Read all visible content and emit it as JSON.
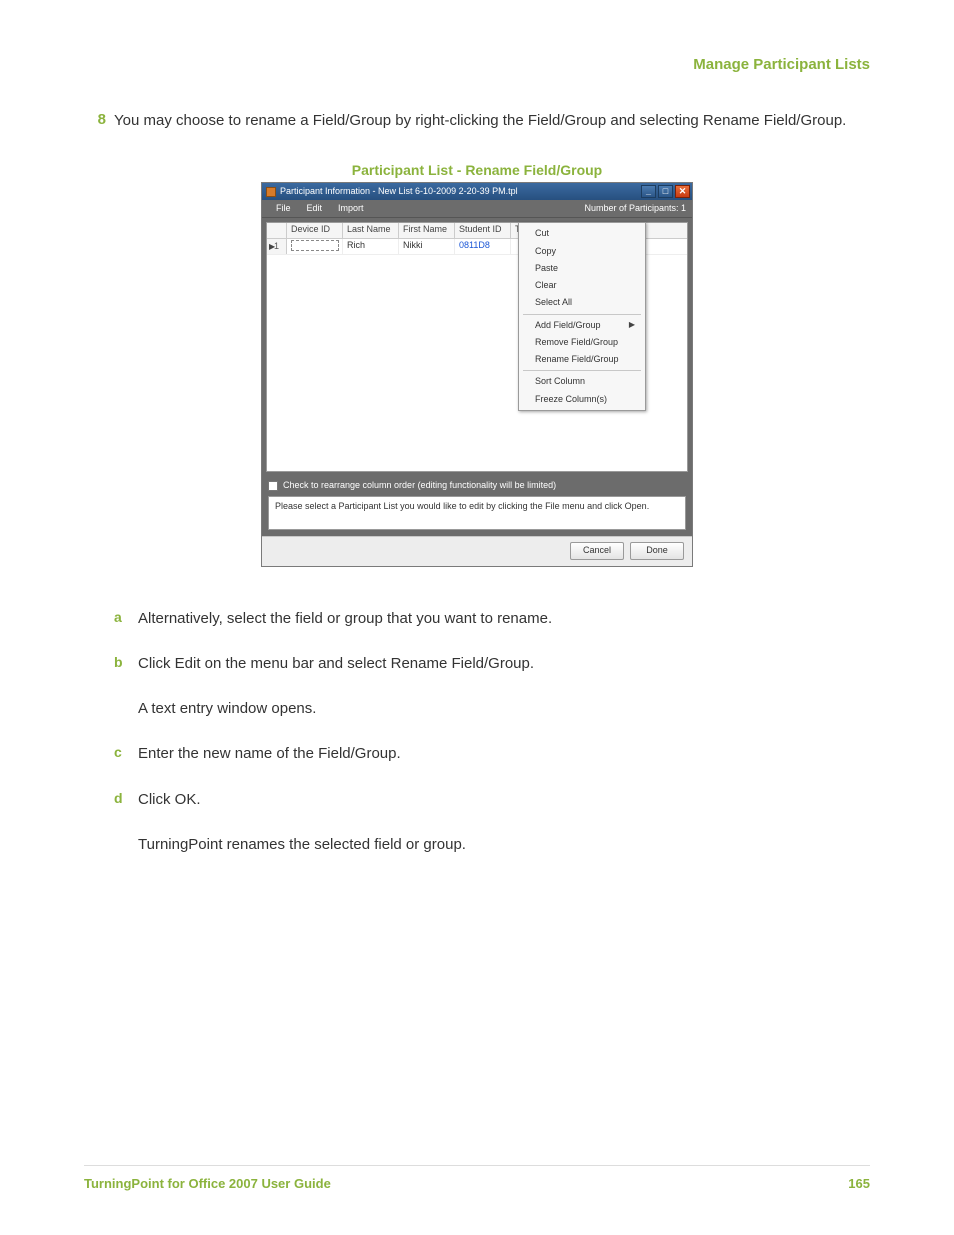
{
  "header": {
    "section_title": "Manage Participant Lists"
  },
  "step": {
    "number": "8",
    "text": "You may choose to rename a Field/Group by right-clicking the Field/Group and selecting Rename Field/Group."
  },
  "figure": {
    "title": "Participant List - Rename Field/Group",
    "window_title": "Participant Information - New List 6-10-2009 2-20-39 PM.tpl",
    "menubar": {
      "file": "File",
      "edit": "Edit",
      "import": "Import",
      "count_label": "Number of Participants: 1"
    },
    "columns": {
      "device_id": "Device ID",
      "last_name": "Last Name",
      "first_name": "First Name",
      "student_id": "Student ID",
      "team": "Team"
    },
    "row": {
      "index": "1",
      "device_id": "",
      "last_name": "Rich",
      "first_name": "Nikki",
      "student_id": "0811D8"
    },
    "context_menu": {
      "cut": "Cut",
      "copy": "Copy",
      "paste": "Paste",
      "clear": "Clear",
      "select_all": "Select All",
      "add": "Add Field/Group",
      "remove": "Remove Field/Group",
      "rename": "Rename Field/Group",
      "sort": "Sort Column",
      "freeze": "Freeze Column(s)"
    },
    "check_label": "Check to rearrange column order (editing functionality will be limited)",
    "info_text": "Please select a Participant List you would like to edit by clicking the File menu and click Open.",
    "buttons": {
      "cancel": "Cancel",
      "done": "Done"
    },
    "win_btns": {
      "min": "_",
      "max": "□",
      "close": "✕"
    }
  },
  "substeps": {
    "a": {
      "letter": "a",
      "text": "Alternatively, select the field or group that you want to rename."
    },
    "b": {
      "letter": "b",
      "text": "Click Edit on the menu bar and select Rename Field/Group."
    },
    "b_result": "A text entry window opens.",
    "c": {
      "letter": "c",
      "text": "Enter the new name of the Field/Group."
    },
    "d": {
      "letter": "d",
      "text": "Click OK."
    },
    "d_result": "TurningPoint renames the selected field or group."
  },
  "footer": {
    "guide": "TurningPoint for Office 2007 User Guide",
    "page": "165"
  }
}
